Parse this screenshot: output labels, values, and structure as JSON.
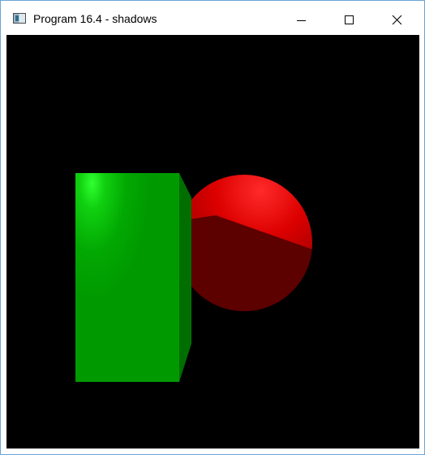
{
  "window": {
    "title": "Program 16.4 - shadows",
    "icon": "app-window-icon"
  },
  "controls": {
    "minimize_icon": "minimize-icon",
    "maximize_icon": "maximize-icon",
    "close_icon": "close-icon"
  },
  "scene": {
    "background": "#000000",
    "objects": [
      {
        "name": "cube",
        "color": "#00a800",
        "highlight": "#20ff20",
        "side": "#006d00"
      },
      {
        "name": "sphere",
        "color": "#e00000",
        "shadow": "#5a0000"
      }
    ]
  }
}
